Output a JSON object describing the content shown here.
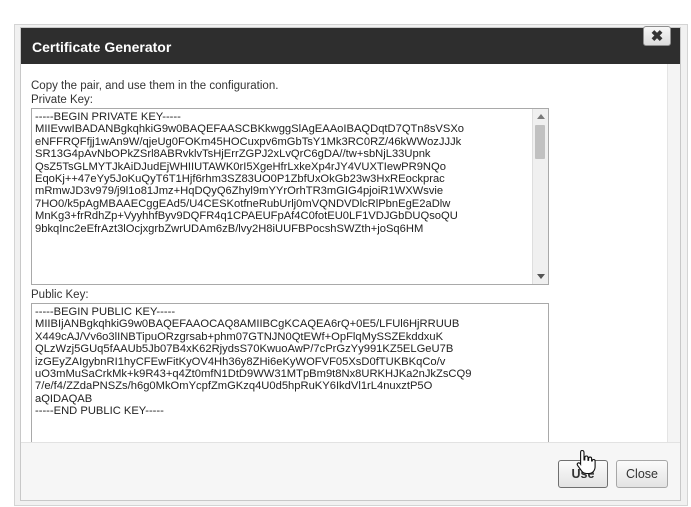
{
  "dialog": {
    "title": "Certificate Generator",
    "close_glyph": "✖",
    "instructions": "Copy the pair, and use them in the configuration.",
    "private_key_label": "Private Key:",
    "public_key_label": "Public Key:",
    "private_key_value": "-----BEGIN PRIVATE KEY-----\nMIIEvwIBADANBgkqhkiG9w0BAQEFAASCBKkwggSlAgEAAoIBAQDqtD7QTn8sVSXo\neNFFRQFfjj1wAn9W/qjeUg0FOKm45HOCuxpv6mGbTsY1Mk3RC0RZ/46kWWozJJJk\nSR13G4pAvNbOPkZSrl8ABRvklvTsHjErrZGPJ2xLvQrC6gDA//tw+sbNjL33Upnk\nQsZ5TsGLMYTJkAiDJudEjWHIIUTAWK0rI5XgeHfrLxkeXp4rJY4VUXTIewPR9NQo\nEqoKj++47eYy5JoKuQyT6T1Hjf6rhm3SZ83UO0P1ZbfUxOkGb23w3HxREockprac\nmRmwJD3v979/j9l1o81Jmz+HqDQyQ6Zhyl9mYYrOrhTR3mGIG4pjoiR1WXWsvie\n7HO0/k5pAgMBAAECggEAd5/U4CESKotfneRubUrlj0mVQNDVDlcRlPbnEgE2aDlw\nMnKg3+frRdhZp+VyyhhfByv9DQFR4q1CPAEUFpAf4C0fotEU0LF1VDJGbDUQsoQU\n9bkqInc2eEfrAzt3lOcjxgrbZwrUDAm6zB/lvy2H8iUUFBPocshSWZth+joSq6HM",
    "public_key_value": "-----BEGIN PUBLIC KEY-----\nMIIBIjANBgkqhkiG9w0BAQEFAAOCAQ8AMIIBCgKCAQEA6rQ+0E5/LFUl6HjRRUUB\nX449cAJ/Vv6o3lINBTipuORzgrsab+phm07GTNJN0QtEWf+OpFlqMySSZEkddxuK\nQLzWzj5GUq5fAAUb5Jb07B4xK62RjydsS70KwuoAwP/7cPrGzYy991KZ5ELGeU7B\nizGEyZAIgybnRI1hyCFEwFitKyOV4Hh36y8ZHi6eKyWOFVF05XsD0fTUKBKqCo/v\nuO3mMuSaCrkMk+k9R43+q4Zt0mfN1DtD9WW31MTpBm9t8Nx8URKHJKa2nJkZsCQ9\n7/e/f4/ZZdaPNSZs/h6g0MkOmYcpfZmGKzq4U0d5hpRuKY6IkdVl1rL4nuxztP5O\naQIDAQAB\n-----END PUBLIC KEY-----",
    "use_label": "Use",
    "close_label": "Close"
  }
}
